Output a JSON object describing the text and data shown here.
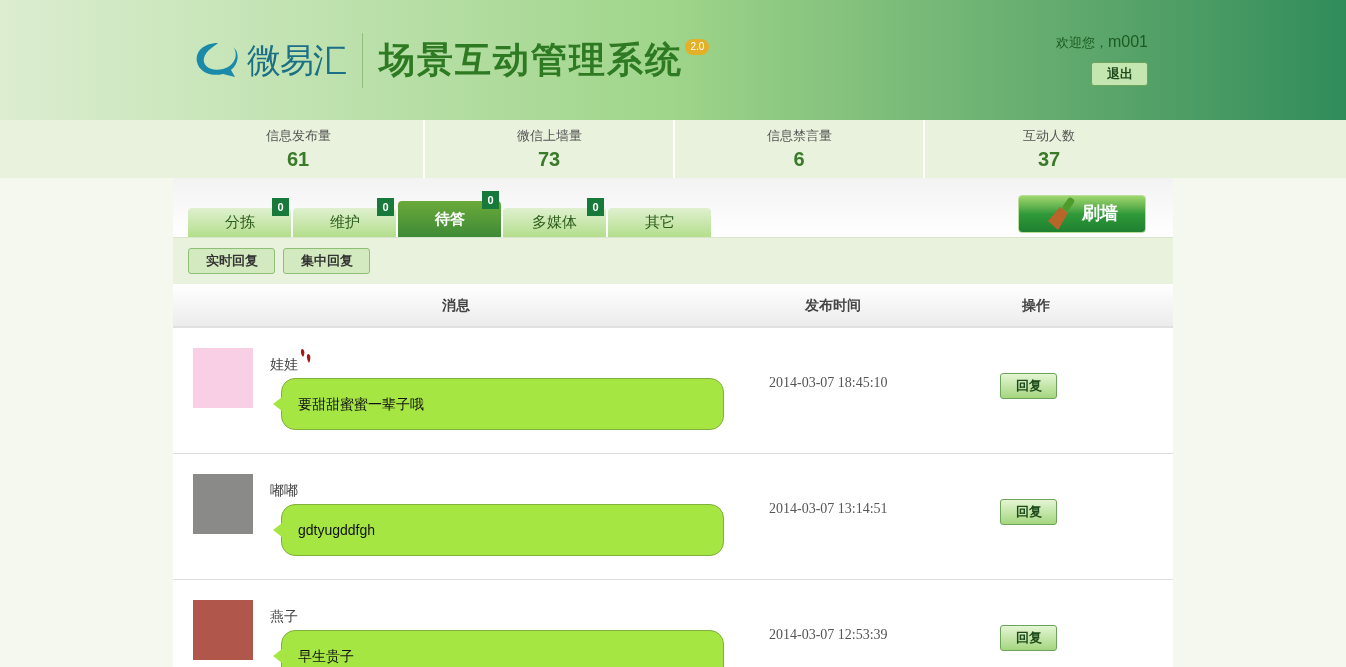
{
  "header": {
    "logo_text": "微易汇",
    "title": "场景互动管理系统",
    "version": "2.0",
    "welcome": "欢迎您，",
    "username": "m001",
    "logout": "退出"
  },
  "stats": [
    {
      "label": "信息发布量",
      "value": "61"
    },
    {
      "label": "微信上墙量",
      "value": "73"
    },
    {
      "label": "信息禁言量",
      "value": "6"
    },
    {
      "label": "互动人数",
      "value": "37"
    }
  ],
  "tabs": [
    {
      "label": "分拣",
      "count": "0",
      "selected": false
    },
    {
      "label": "维护",
      "count": "0",
      "selected": false
    },
    {
      "label": "待答",
      "count": "0",
      "selected": true
    },
    {
      "label": "多媒体",
      "count": "0",
      "selected": false
    },
    {
      "label": "其它",
      "selected": false
    }
  ],
  "wall_button": "刷墙",
  "sub_buttons": [
    "实时回复",
    "集中回复"
  ],
  "table": {
    "columns": [
      "消息",
      "发布时间",
      "操作"
    ],
    "rows": [
      {
        "name": "娃娃",
        "marked": true,
        "message": "要甜甜蜜蜜一辈子哦",
        "time": "2014-03-07 18:45:10",
        "action": "回复"
      },
      {
        "name": "嘟嘟",
        "marked": false,
        "message": "gdtyugddfgh",
        "time": "2014-03-07 13:14:51",
        "action": "回复"
      },
      {
        "name": "燕子",
        "marked": false,
        "message": "早生贵子",
        "time": "2014-03-07 12:53:39",
        "action": "回复"
      }
    ]
  }
}
